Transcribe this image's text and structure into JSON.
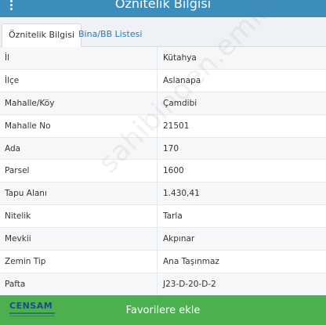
{
  "header": {
    "title": "Öznitelik Bilgisi",
    "menu_icon": "vertical-dots-icon"
  },
  "tabs": [
    {
      "label": "Öznitelik Bilgisi",
      "active": true
    },
    {
      "label": "Bina/BB Listesi",
      "active": false
    }
  ],
  "attributes": [
    {
      "label": "İl",
      "value": "Kütahya"
    },
    {
      "label": "İlçe",
      "value": "Aslanapa"
    },
    {
      "label": "Mahalle/Köy",
      "value": "Çamdibi"
    },
    {
      "label": "Mahalle No",
      "value": "21501"
    },
    {
      "label": "Ada",
      "value": "170"
    },
    {
      "label": "Parsel",
      "value": "1600"
    },
    {
      "label": "Tapu Alanı",
      "value": "1.430,41"
    },
    {
      "label": "Nitelik",
      "value": "Tarla"
    },
    {
      "label": "Mevkii",
      "value": "Akpınar"
    },
    {
      "label": "Zemin Tip",
      "value": "Ana Taşınmaz"
    },
    {
      "label": "Pafta",
      "value": "J23-D-20-D-2"
    }
  ],
  "watermark": "sahibinden.emlakjet.com",
  "footer": {
    "button_label": "Favorilere ekle",
    "logo_text": "CENSAM"
  },
  "colors": {
    "header": "#3c8dbc",
    "footer": "#4caf50",
    "tab_link": "#2c7bb6"
  }
}
